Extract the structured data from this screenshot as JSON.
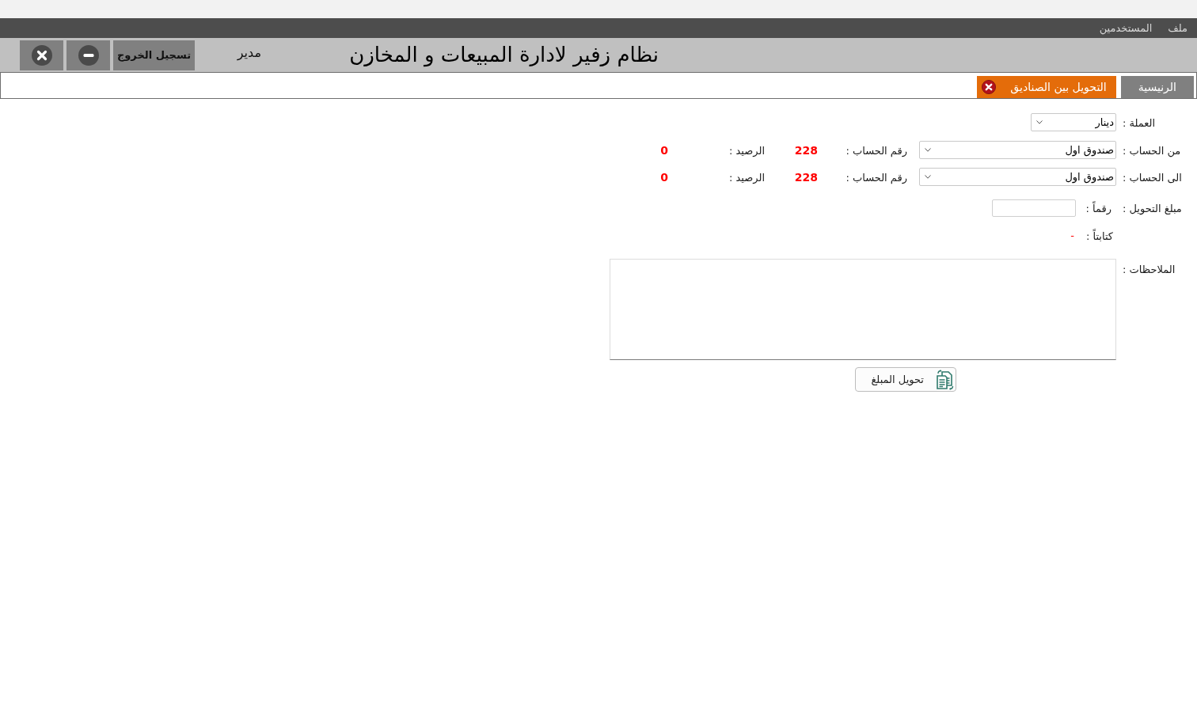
{
  "menu_bar": {
    "items": [
      "ملف",
      "المستخدمين"
    ]
  },
  "header": {
    "title": "نظام زفير لادارة المبيعات و المخازن",
    "user": "مدير",
    "buttons": [
      {
        "kind": "logout",
        "label": "تسجيل الخروج"
      },
      {
        "kind": "minimize"
      },
      {
        "kind": "close"
      }
    ]
  },
  "tabs": [
    {
      "label": "الرنيسية",
      "selected": false,
      "closable": false
    },
    {
      "label": "التحويل بين الصناديق",
      "selected": true,
      "closable": true
    }
  ],
  "form": {
    "currency": {
      "label": "العملة :",
      "value": "دينار"
    },
    "accounts": [
      {
        "label": "من الحساب :",
        "value": "صندوق اول",
        "number_label": "رقم الحساب :",
        "number": "228",
        "balance_label": "الرصيد :",
        "balance": "0"
      },
      {
        "label": "الى الحساب :",
        "value": "صندوق اول",
        "number_label": "رقم الحساب :",
        "number": "228",
        "balance_label": "الرصيد :",
        "balance": "0"
      }
    ],
    "amount": {
      "label": "مبلغ التحويل :",
      "numeric_label": "رقماً :",
      "words_label": "كتابتاً :",
      "words_value": "-"
    },
    "notes": {
      "label": "الملاحظات :"
    },
    "submit": {
      "label": "تحويل المبلغ"
    }
  }
}
